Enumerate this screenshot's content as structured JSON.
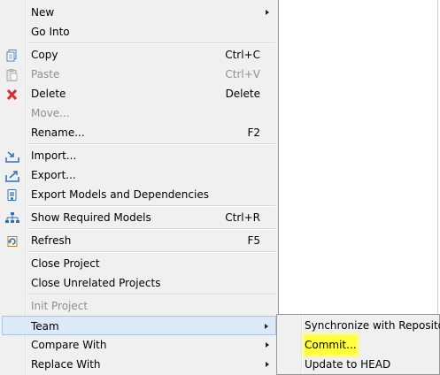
{
  "menu": {
    "items": [
      {
        "label": "New"
      },
      {
        "label": "Go Into"
      },
      {
        "label": "Copy",
        "shortcut": "Ctrl+C",
        "icon": "copy-icon"
      },
      {
        "label": "Paste",
        "shortcut": "Ctrl+V",
        "icon": "paste-icon",
        "disabled": true
      },
      {
        "label": "Delete",
        "shortcut": "Delete",
        "icon": "delete-icon"
      },
      {
        "label": "Move...",
        "disabled": true
      },
      {
        "label": "Rename...",
        "shortcut": "F2"
      },
      {
        "label": "Import...",
        "icon": "import-icon"
      },
      {
        "label": "Export...",
        "icon": "export-icon"
      },
      {
        "label": "Export Models and Dependencies",
        "icon": "export-models-icon"
      },
      {
        "label": "Show Required Models",
        "shortcut": "Ctrl+R",
        "icon": "show-required-models-icon"
      },
      {
        "label": "Refresh",
        "shortcut": "F5",
        "icon": "refresh-icon"
      },
      {
        "label": "Close Project"
      },
      {
        "label": "Close Unrelated Projects"
      },
      {
        "label": "Init Project",
        "disabled": true
      },
      {
        "label": "Team",
        "selected": true
      },
      {
        "label": "Compare With"
      },
      {
        "label": "Replace With"
      }
    ]
  },
  "submenu": {
    "items": [
      {
        "label": "Synchronize with Repository"
      },
      {
        "label": "Commit...",
        "highlighted": true,
        "highlight_color": "#ffff3a"
      },
      {
        "label": "Update to HEAD"
      }
    ]
  },
  "colors": {
    "menu_bg": "#f0f0f0",
    "selected_bg": "#dbe9f8",
    "disabled_text": "#8f8f8f",
    "delete_icon": "#d62c2c",
    "icon_blue": "#2f6fb6"
  }
}
